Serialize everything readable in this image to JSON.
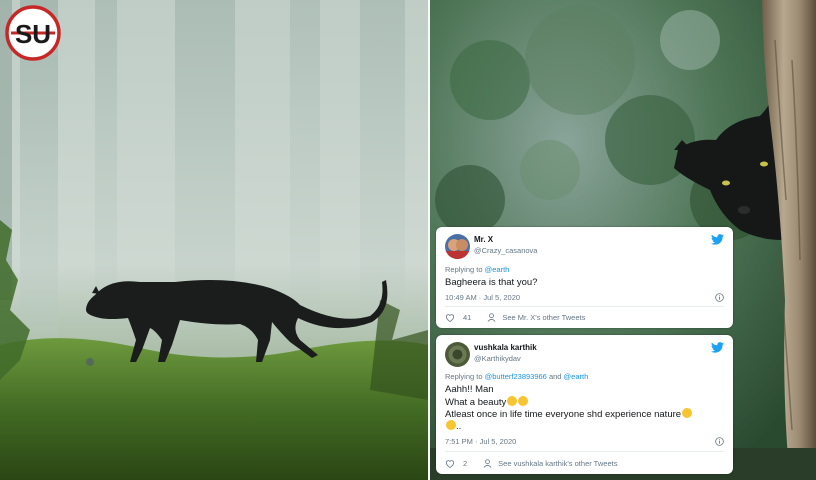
{
  "logo": {
    "text": "SU",
    "colors": {
      "ring": "#c62828",
      "letters": "#1a1a1a"
    }
  },
  "left_image": {
    "subject": "black panther walking through misty forest",
    "icon": "black-panther-walking"
  },
  "right_image": {
    "subject": "black panther peeking from behind tree trunk",
    "icon": "black-panther-peeking"
  },
  "tweets": [
    {
      "name": "Mr. X",
      "handle": "@Crazy_casanova",
      "replying_prefix": "Replying to ",
      "replying_to": "@earth",
      "lines": [
        "Bagheera is that you?"
      ],
      "timestamp": "10:49 AM · Jul 5, 2020",
      "likes": "41",
      "see_more": "See Mr. X's other Tweets"
    },
    {
      "name": "vushkala karthik",
      "handle": "@Karthikydav",
      "replying_prefix": "Replying to ",
      "replying_to": "@butterf23893966",
      "replying_and": " and ",
      "replying_to2": "@earth",
      "lines": [
        "Aahh!! Man",
        "What a beauty",
        "Atleast once in life time everyone shd experience nature",
        ".."
      ],
      "timestamp": "7:51 PM · Jul 5, 2020",
      "likes": "2",
      "see_more": "See vushkala karthik's other Tweets"
    }
  ],
  "colors": {
    "twitter_blue": "#1da1f2",
    "text": "#14171a",
    "muted": "#657786",
    "link": "#1b95e0"
  }
}
